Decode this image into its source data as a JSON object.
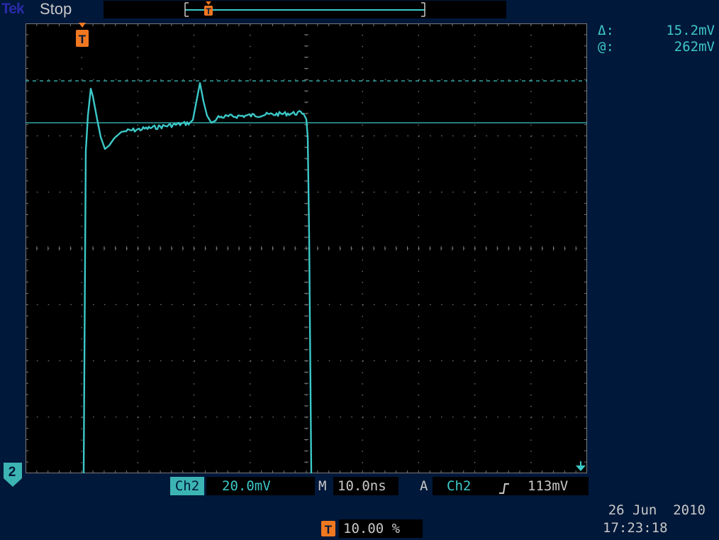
{
  "header": {
    "logo": "Tek",
    "status": "Stop",
    "trigger_marker": "T"
  },
  "readout": {
    "delta_symbol": "Δ:",
    "delta_value": "15.2mV",
    "at_symbol": "@:",
    "at_value": "262mV"
  },
  "channel": {
    "marker": "2",
    "name": "Ch2",
    "scale": "20.0mV"
  },
  "timebase": {
    "label": "M",
    "value": "10.0ns"
  },
  "trigger": {
    "mode": "A",
    "source": "Ch2",
    "slope_icon": "rising-edge-icon",
    "level": "113mV",
    "position_marker": "T",
    "position": "10.00 %"
  },
  "datetime": {
    "date": "26 Jun  2010",
    "time": "17:23:18"
  },
  "colors": {
    "background": "#00183a",
    "trace": "#3cc8c8",
    "trigger": "#f07820",
    "grid": "#7a7a7a"
  }
}
